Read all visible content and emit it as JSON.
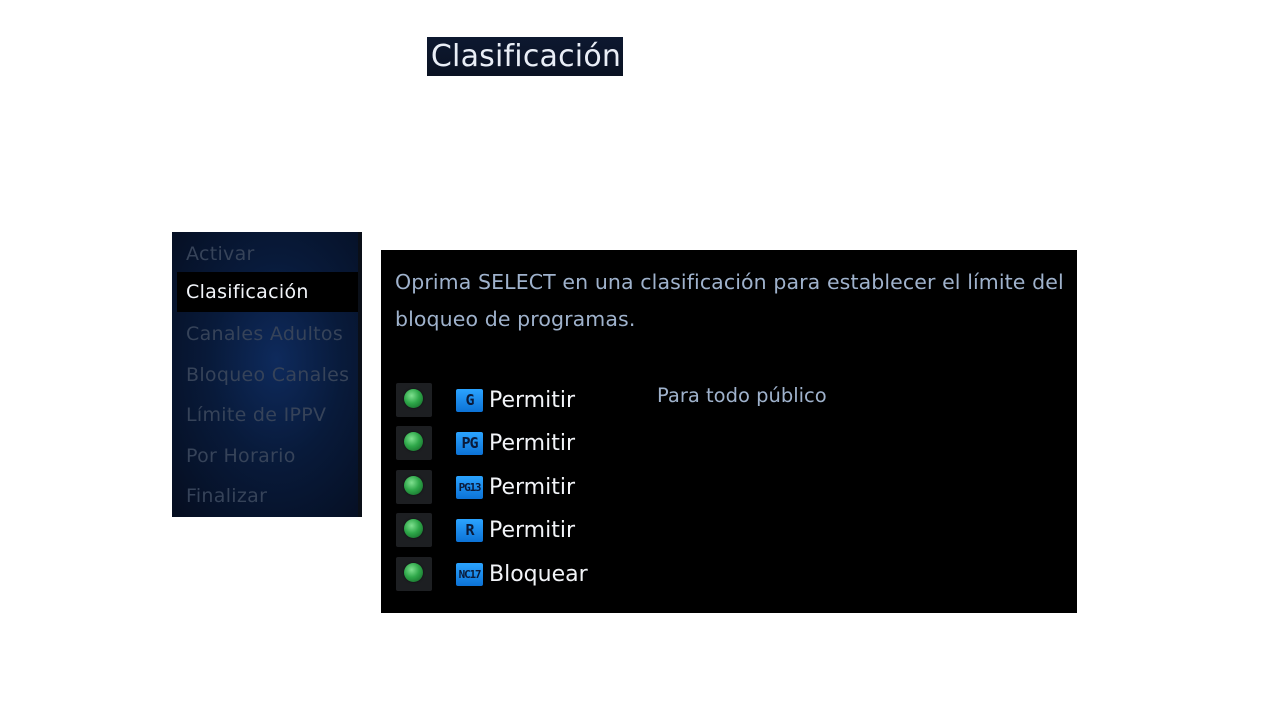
{
  "title": "Clasificación",
  "side_menu": {
    "items": [
      {
        "label": "Activar",
        "active": false
      },
      {
        "label": "Clasificación",
        "active": true
      },
      {
        "label": "Canales Adultos",
        "active": false
      },
      {
        "label": "Bloqueo Canales",
        "active": false
      },
      {
        "label": "Límite de IPPV",
        "active": false
      },
      {
        "label": "Por Horario",
        "active": false
      },
      {
        "label": "Finalizar",
        "active": false
      }
    ]
  },
  "main": {
    "instructions": "Oprima SELECT en una clasificación para establecer el límite del bloqueo de programas.",
    "selected_description": "Para todo público",
    "ratings": [
      {
        "code": "G",
        "status": "Permitir",
        "indicator": "green-dot"
      },
      {
        "code": "PG",
        "status": "Permitir",
        "indicator": "green-dot"
      },
      {
        "code": "PG13",
        "status": "Permitir",
        "indicator": "green-dot"
      },
      {
        "code": "R",
        "status": "Permitir",
        "indicator": "green-dot"
      },
      {
        "code": "NC17",
        "status": "Bloquear",
        "indicator": "green-dot"
      }
    ]
  },
  "colors": {
    "accent_blue": "#1a8ef0",
    "indicator_green": "#2fa84a",
    "text_light": "#f2f4f8",
    "text_muted": "#9fb2cc"
  }
}
